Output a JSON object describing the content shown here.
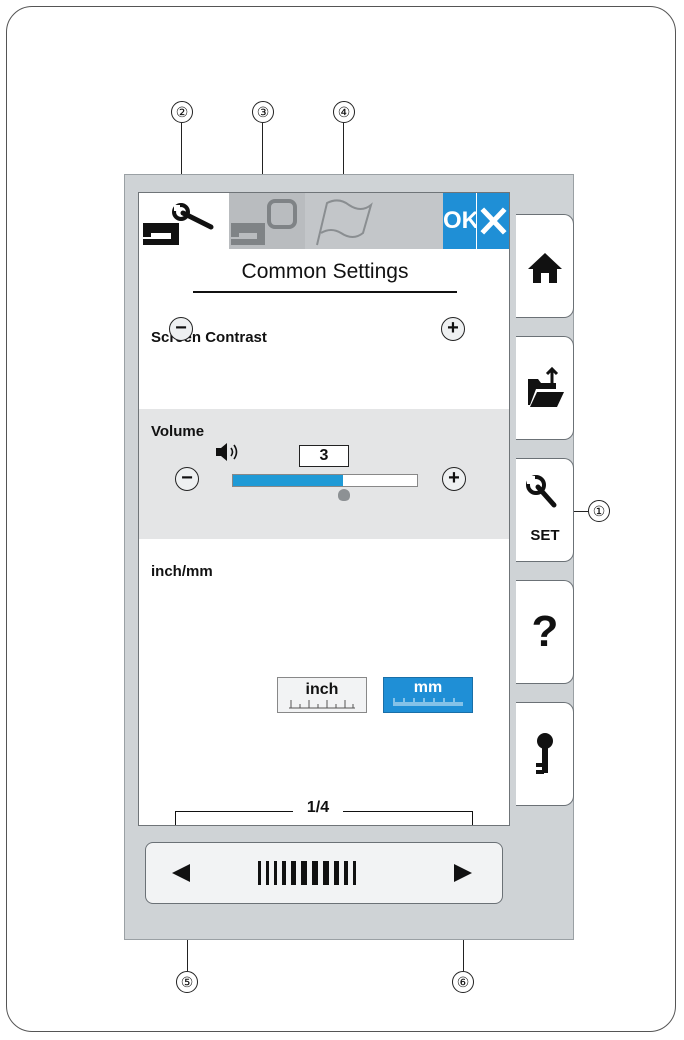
{
  "callouts": {
    "set_button": "①",
    "tab_machine_settings": "②",
    "tab_embroidery_settings": "③",
    "tab_language_settings": "④",
    "prev_page": "⑤",
    "next_page": "⑥"
  },
  "tabs": [
    {
      "icon": "wrench-machine-icon",
      "active": true
    },
    {
      "icon": "hoop-machine-icon",
      "active": false
    },
    {
      "icon": "flag-icon",
      "active": false
    }
  ],
  "toolbar": {
    "ok_label": "OK",
    "close_icon": "close-icon"
  },
  "screen": {
    "title": "Common Settings",
    "contrast": {
      "label": "Screen Contrast",
      "colors": [
        "#e3001b",
        "#f2750d",
        "#f7b400",
        "#e7e300",
        "#9ccf1a",
        "#22b24c",
        "#16a98a",
        "#1e5bd3",
        "#1a2ea8",
        "#6a1fb5",
        "#b21fa9",
        "#e2197a",
        "#ffffff"
      ]
    },
    "volume": {
      "label": "Volume",
      "value": "3",
      "level": 0.6,
      "speaker_icon": "speaker-icon"
    },
    "units": {
      "label": "inch/mm",
      "inch_label": "inch",
      "mm_label": "mm",
      "selected": "mm"
    },
    "page_indicator": "1/4"
  },
  "sidebar": [
    {
      "icon": "home-icon"
    },
    {
      "icon": "folder-open-icon"
    },
    {
      "icon": "wrench-icon",
      "label": "SET"
    },
    {
      "icon": "help-icon",
      "label": "?"
    },
    {
      "icon": "key-icon"
    }
  ],
  "nav": {
    "prev_icon": "arrow-left-icon",
    "next_icon": "arrow-right-icon",
    "grip_icon": "grip-icon"
  },
  "colors": {
    "accent": "#1f8fd6",
    "device": "#cfd3d6",
    "band": "#e4e5e6"
  }
}
